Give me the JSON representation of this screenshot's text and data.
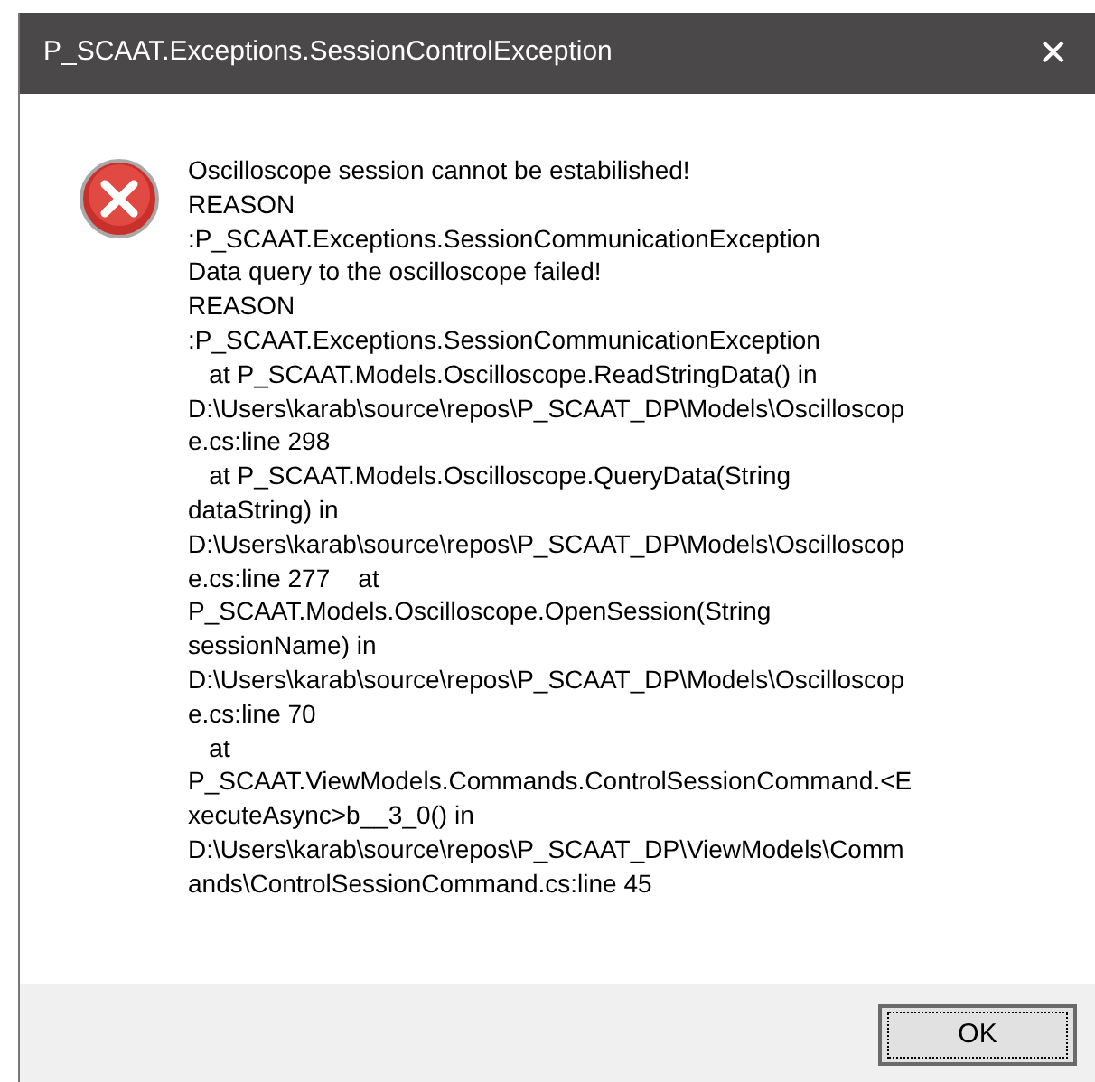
{
  "window": {
    "title": "P_SCAAT.Exceptions.SessionControlException",
    "close": "✕"
  },
  "message": {
    "lines": [
      "Oscilloscope session cannot be estabilished!",
      "REASON",
      ":P_SCAAT.Exceptions.SessionCommunicationException",
      "Data query to the oscilloscope failed!",
      "REASON",
      ":P_SCAAT.Exceptions.SessionCommunicationException",
      "   at P_SCAAT.Models.Oscilloscope.ReadStringData() in",
      "D:\\Users\\karab\\source\\repos\\P_SCAAT_DP\\Models\\Oscilloscop",
      "e.cs:line 298",
      "   at P_SCAAT.Models.Oscilloscope.QueryData(String",
      "dataString) in",
      "D:\\Users\\karab\\source\\repos\\P_SCAAT_DP\\Models\\Oscilloscop",
      "e.cs:line 277    at",
      "P_SCAAT.Models.Oscilloscope.OpenSession(String",
      "sessionName) in",
      "D:\\Users\\karab\\source\\repos\\P_SCAAT_DP\\Models\\Oscilloscop",
      "e.cs:line 70",
      "   at",
      "P_SCAAT.ViewModels.Commands.ControlSessionCommand.<E",
      "xecuteAsync>b__3_0() in",
      "D:\\Users\\karab\\source\\repos\\P_SCAAT_DP\\ViewModels\\Comm",
      "ands\\ControlSessionCommand.cs:line 45"
    ]
  },
  "buttons": [
    {
      "label": "OK",
      "selected": true
    }
  ]
}
